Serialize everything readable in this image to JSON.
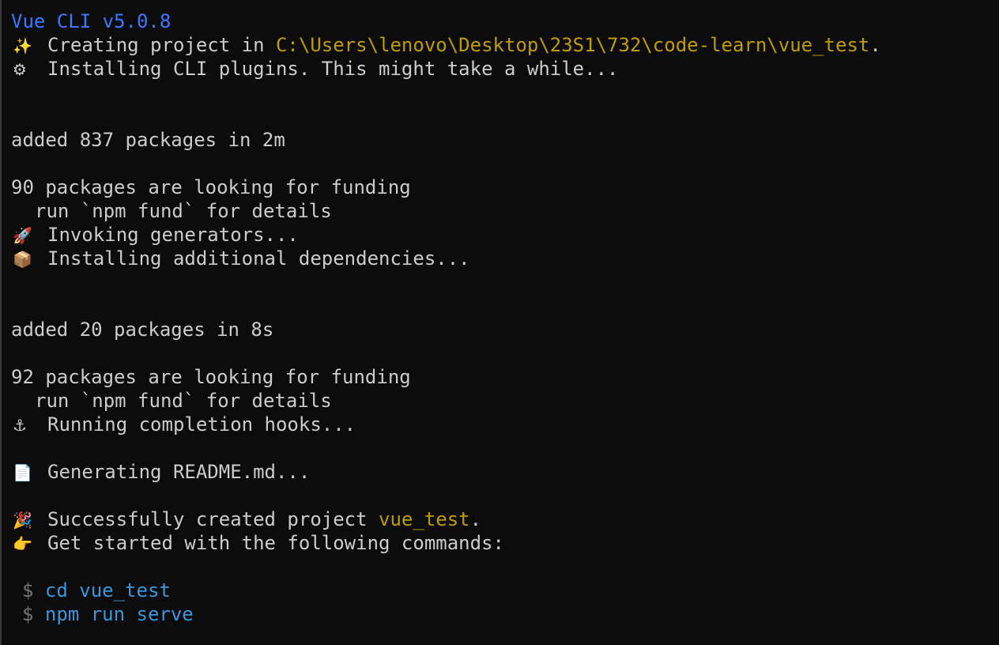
{
  "header": {
    "version": "Vue CLI v5.0.8"
  },
  "creating": {
    "icon": "✨",
    "text": "Creating project in ",
    "path": "C:\\Users\\lenovo\\Desktop\\23S1\\732\\code-learn\\vue_test",
    "tail": "."
  },
  "installing_plugins": {
    "icon": "⚙",
    "text": "Installing CLI plugins. This might take a while..."
  },
  "added_1": "added 837 packages in 2m",
  "funding_1": "90 packages are looking for funding",
  "fund_hint_1": "run `npm fund` for details",
  "invoking": {
    "icon": "🚀",
    "text": "Invoking generators..."
  },
  "additional": {
    "icon": "📦",
    "text": "Installing additional dependencies..."
  },
  "added_2": "added 20 packages in 8s",
  "funding_2": "92 packages are looking for funding",
  "fund_hint_2": "run `npm fund` for details",
  "hooks": {
    "icon": "⚓",
    "text": "Running completion hooks..."
  },
  "readme": {
    "icon": "📄",
    "text": "Generating README.md..."
  },
  "success": {
    "icon": "🎉",
    "text": "Successfully created project ",
    "project": "vue_test",
    "tail": "."
  },
  "get_started": {
    "icon": "👉",
    "text": "Get started with the following commands:"
  },
  "commands": [
    {
      "prompt": "$",
      "cmd": "cd vue_test"
    },
    {
      "prompt": "$",
      "cmd": "npm run serve"
    }
  ],
  "colors": {
    "background": "#0c0c0c",
    "text": "#cccccc",
    "version_blue": "#3b78ff",
    "path_yellow": "#c19c00",
    "command_blue": "#3a96dd"
  },
  "icons": {
    "creating": "sparkles-icon",
    "installing_plugins": "gear-icon",
    "invoking": "rocket-icon",
    "additional": "package-icon",
    "hooks": "anchor-icon",
    "readme": "document-icon",
    "success": "party-popper-icon",
    "get_started": "pointing-hand-icon"
  }
}
